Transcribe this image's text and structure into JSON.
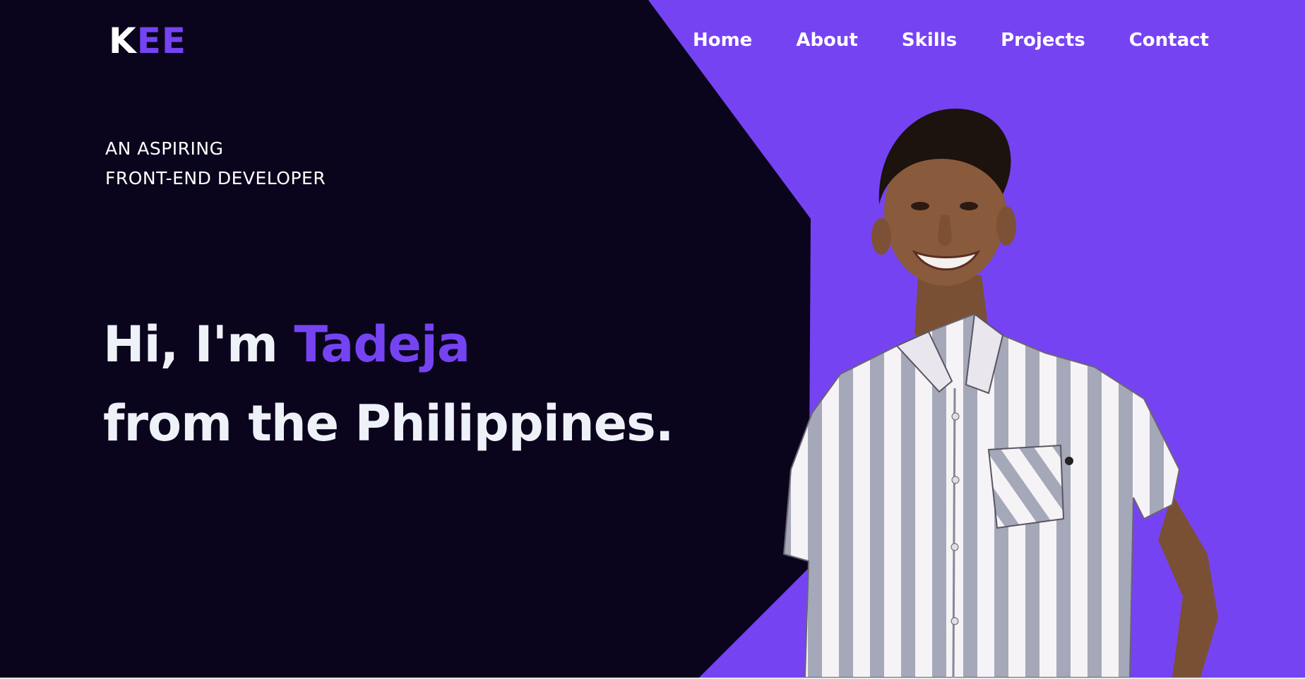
{
  "logo": {
    "k": "K",
    "ee": "EE"
  },
  "nav": {
    "items": [
      {
        "label": "Home"
      },
      {
        "label": "About"
      },
      {
        "label": "Skills"
      },
      {
        "label": "Projects"
      },
      {
        "label": "Contact"
      }
    ]
  },
  "tagline": {
    "line1": "AN ASPIRING",
    "line2": "FRONT-END DEVELOPER"
  },
  "hero": {
    "greeting": "Hi, I'm ",
    "name": "Tadeja",
    "line2": "from the Philippines."
  },
  "colors": {
    "background": "#0a051c",
    "accent": "#7643f3",
    "text": "#ffffff"
  }
}
